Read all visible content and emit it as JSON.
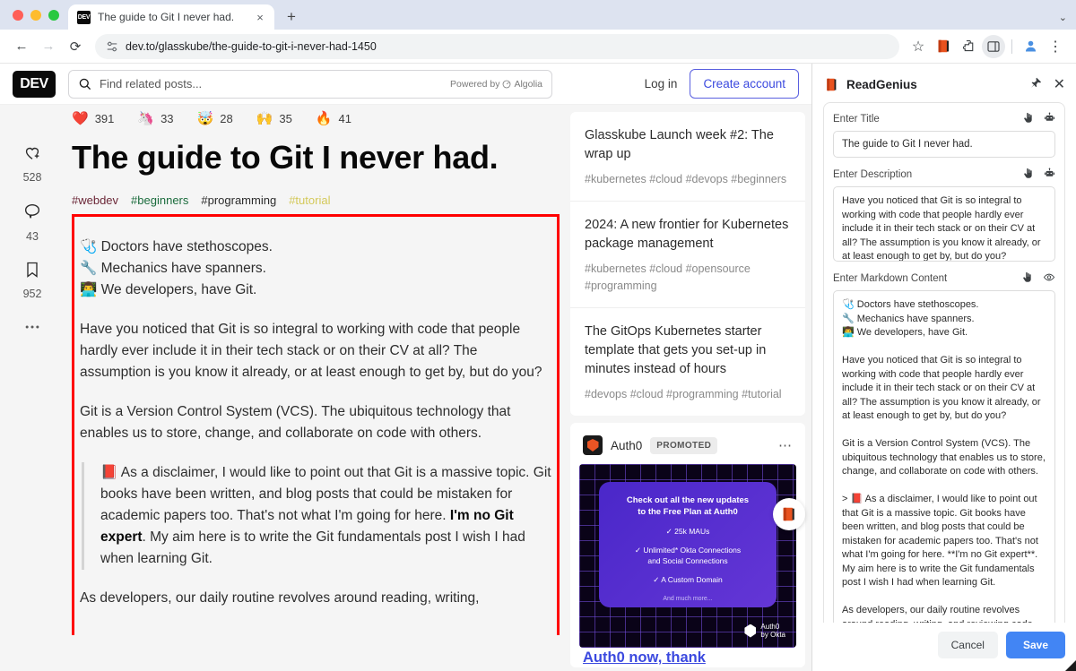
{
  "browser": {
    "tab": {
      "title": "The guide to Git I never had.",
      "favicon": "dev-favicon",
      "close": "×"
    },
    "new_tab": "+",
    "tabstrip_right": "⌄",
    "nav": {
      "back": "←",
      "forward": "→",
      "reload": "⟳"
    },
    "url": "dev.to/glasskube/the-guide-to-git-i-never-had-1450",
    "toolbar_icons": [
      "star-icon",
      "readgenius-extension-icon",
      "extensions-puzzle-icon",
      "side-panel-icon",
      "profile-avatar-icon",
      "chrome-menu-icon"
    ],
    "star": "☆",
    "menu_dots": "⋮"
  },
  "dev_header": {
    "logo": "DEV",
    "search_placeholder": "Find related posts...",
    "powered_by": "Powered by",
    "algolia": "Algolia",
    "login": "Log in",
    "create_account": "Create account"
  },
  "rail": {
    "items": [
      {
        "name": "reaction-heart",
        "icon": "heart-plus-icon",
        "count": "528"
      },
      {
        "name": "comments",
        "icon": "comment-icon",
        "count": "43"
      },
      {
        "name": "bookmarks",
        "icon": "bookmark-icon",
        "count": "952"
      },
      {
        "name": "more-options",
        "icon": "ellipsis-icon",
        "count": ""
      }
    ]
  },
  "article": {
    "reactions": [
      {
        "emoji": "❤️",
        "name": "heart",
        "count": "391"
      },
      {
        "emoji": "🦄",
        "name": "unicorn",
        "count": "33"
      },
      {
        "emoji": "🤯",
        "name": "exploding-head",
        "count": "28"
      },
      {
        "emoji": "🙌",
        "name": "raised-hands",
        "count": "35"
      },
      {
        "emoji": "🔥",
        "name": "fire",
        "count": "41"
      }
    ],
    "title": "The guide to Git I never had.",
    "tags": [
      {
        "label": "#webdev",
        "cls": "tag-webdev"
      },
      {
        "label": "#beginners",
        "cls": "tag-beginners"
      },
      {
        "label": "#programming",
        "cls": "tag-programming"
      },
      {
        "label": "#tutorial",
        "cls": "tag-tutorial"
      }
    ],
    "intro_line1": "🩺 Doctors have stethoscopes.",
    "intro_line2": "🔧 Mechanics have spanners.",
    "intro_line3": "👨‍💻 We developers, have Git.",
    "para1": "Have you noticed that Git is so integral to working with code that people hardly ever include it in their tech stack or on their CV at all? The assumption is you know it already, or at least enough to get by, but do you?",
    "para2": "Git is a Version Control System (VCS). The ubiquitous technology that enables us to store, change, and collaborate on code with others.",
    "quote_pre": "📕 As a disclaimer, I would like to point out that Git is a massive topic. Git books have been written, and blog posts that could be mistaken for academic papers too. That's not what I'm going for here. ",
    "quote_bold": "I'm no Git expert",
    "quote_post": ". My aim here is to write the Git fundamentals post I wish I had when learning Git.",
    "para3": "As developers, our daily routine revolves around reading, writing,"
  },
  "related_posts": [
    {
      "title": "Glasskube Launch week #2: The wrap up",
      "tags": "#kubernetes #cloud #devops #beginners"
    },
    {
      "title": "2024: A new frontier for Kubernetes package management",
      "tags": "#kubernetes #cloud #opensource #programming"
    },
    {
      "title": "The GitOps Kubernetes starter template that gets you set-up in minutes instead of hours",
      "tags": "#devops #cloud #programming #tutorial"
    }
  ],
  "promo": {
    "sponsor": "Auth0",
    "badge": "PROMOTED",
    "dots": "⋯",
    "ad_heading_line1": "Check out all the new updates",
    "ad_heading_line2": "to the Free Plan at Auth0",
    "ad_items": [
      "✓ 25k MAUs",
      "✓ Unlimited* Okta Connections\nand Social Connections",
      "✓ A Custom Domain"
    ],
    "ad_more": "And much more...",
    "ad_brand_line1": "Auth0",
    "ad_brand_line2": "by Okta",
    "link_text": "Auth0 now, thank"
  },
  "extension": {
    "name": "ReadGenius",
    "pin": "📌",
    "close": "✕",
    "fields": [
      {
        "label": "Enter Title",
        "icons": [
          "hand-pointer-icon",
          "robot-icon"
        ],
        "value": "The guide to Git I never had."
      },
      {
        "label": "Enter Description",
        "icons": [
          "hand-pointer-icon",
          "robot-icon"
        ],
        "value": "Have you noticed that Git is so integral to working with code that people hardly ever include it in their tech stack or on their CV at all? The assumption is you know it already, or at least enough to get by, but do you?"
      },
      {
        "label": "Enter Markdown Content",
        "icons": [
          "hand-pointer-icon",
          "eye-icon"
        ],
        "value": "🩺 Doctors have stethoscopes.\n🔧 Mechanics have spanners.\n👨‍💻 We developers, have Git.\n\nHave you noticed that Git is so integral to working with code that people hardly ever include it in their tech stack or on their CV at all? The assumption is you know it already, or at least enough to get by, but do you?\n\nGit is a Version Control System (VCS). The ubiquitous technology that enables us to store, change, and collaborate on code with others.\n\n> 📕 As a disclaimer, I would like to point out that Git is a massive topic. Git books have been written, and blog posts that could be mistaken for academic papers too. That's not what I'm going for here. **I'm no Git expert**. My aim here is to write the Git fundamentals post I wish I had when learning Git.\n\nAs developers, our daily routine revolves around reading, writing, and reviewing code. Git is arguably one of the most important tools we use. Mastering the features and functionalities Git offers is one of the best investments you can make in yourself as a developer."
      }
    ],
    "cancel": "Cancel",
    "save": "Save"
  },
  "colors": {
    "accent_blue": "#3b49df",
    "save_blue": "#4285f4",
    "highlight_red": "#ff0000",
    "tab_strip": "#dde3f0",
    "ad_purple": "#4a27c9"
  }
}
